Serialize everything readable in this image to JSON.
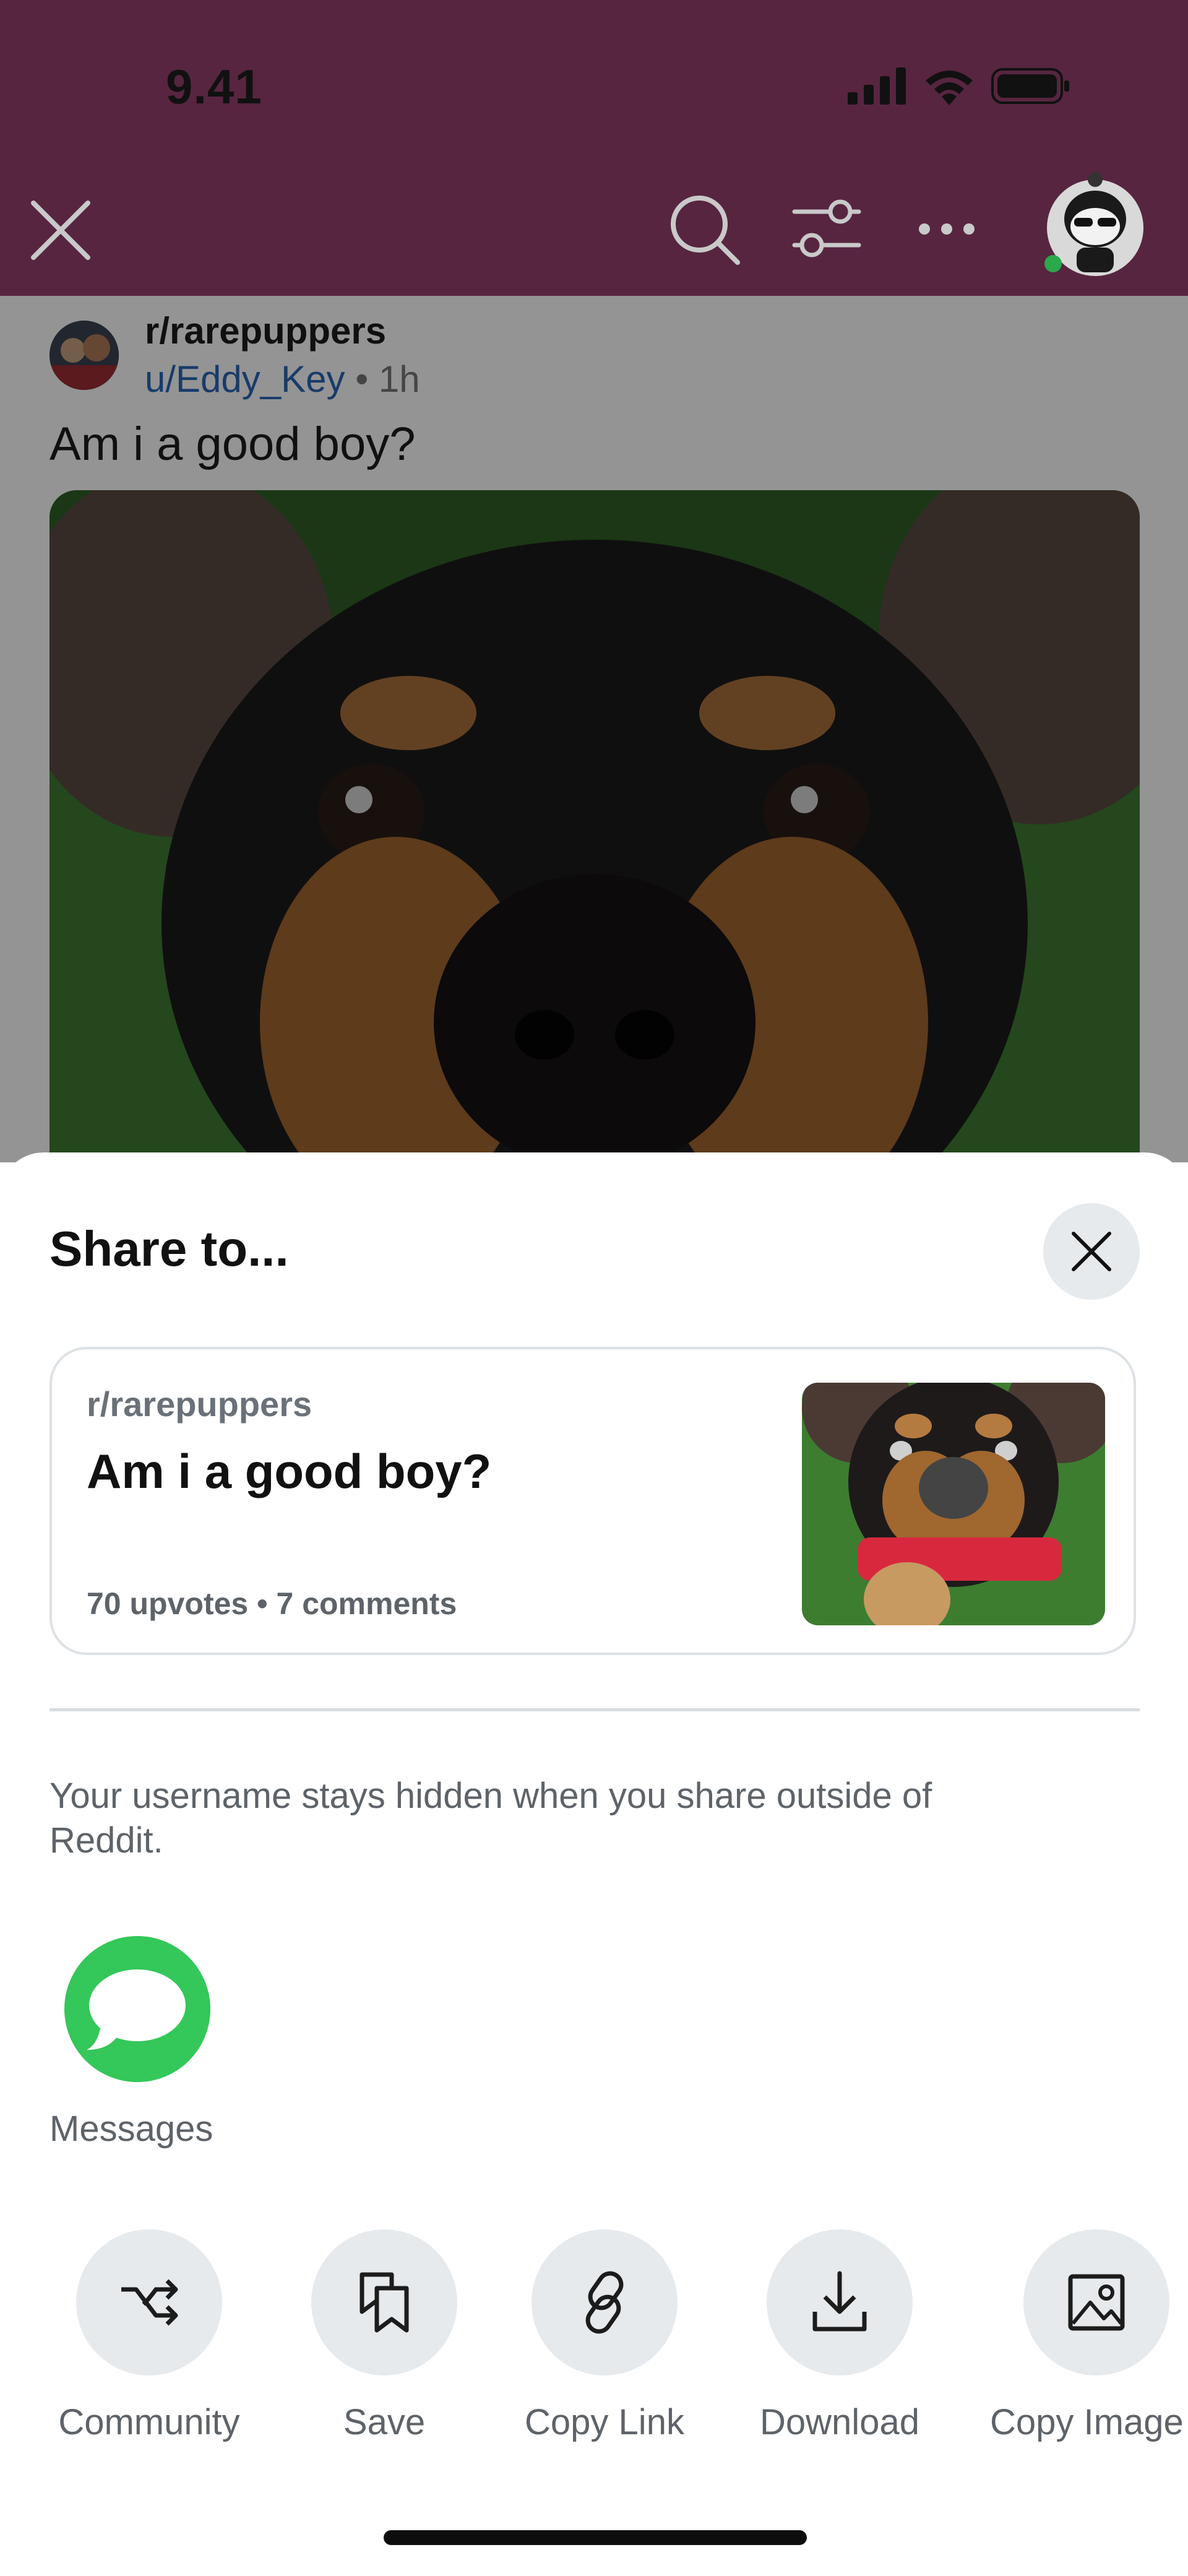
{
  "status_bar": {
    "time": "9.41",
    "icons": [
      "cellular-signal-icon",
      "wifi-icon",
      "battery-icon"
    ]
  },
  "nav": {
    "icons": [
      "close-icon",
      "search-icon",
      "filter-icon",
      "more-icon",
      "avatar"
    ]
  },
  "post": {
    "subreddit": "r/rarepuppers",
    "user": "u/Eddy_Key",
    "age": " • 1h",
    "title": "Am i a good boy?"
  },
  "share_sheet": {
    "title": "Share to...",
    "card": {
      "subreddit": "r/rarepuppers",
      "title": "Am i a good boy?",
      "meta": "70 upvotes • 7 comments"
    },
    "notice": "Your username stays hidden when you share outside of Reddit.",
    "apps": [
      {
        "label": "Messages",
        "icon": "messages-icon"
      }
    ],
    "actions": [
      {
        "label": "Community",
        "icon": "crosspost-icon"
      },
      {
        "label": "Save",
        "icon": "save-icon"
      },
      {
        "label": "Copy Link",
        "icon": "link-icon"
      },
      {
        "label": "Download",
        "icon": "download-icon"
      },
      {
        "label": "Copy Image",
        "icon": "image-icon"
      }
    ]
  },
  "colors": {
    "header": "#572540",
    "messages_green": "#34c759",
    "link_blue": "#2a66b8"
  }
}
